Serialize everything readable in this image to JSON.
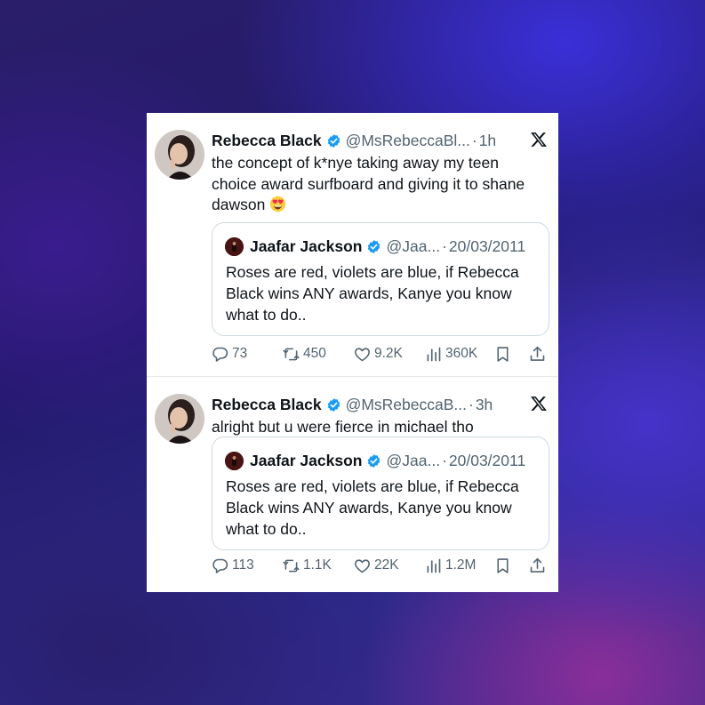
{
  "tweets": [
    {
      "author_name": "Rebecca Black",
      "handle": "@MsRebeccaBl...",
      "separator": "·",
      "time": "1h",
      "text": "the concept of k*nye taking away my teen choice award surfboard and giving it to shane dawson",
      "emoji": "heart-eyes-emoji",
      "quote": {
        "author_name": "Jaafar Jackson",
        "handle": "@Jaa...",
        "separator": "·",
        "date": "20/03/2011",
        "text": "Roses are red, violets are blue, if Rebecca Black wins ANY awards, Kanye you know what to do.."
      },
      "stats": {
        "replies": "73",
        "retweets": "450",
        "likes": "9.2K",
        "views": "360K"
      }
    },
    {
      "author_name": "Rebecca Black",
      "handle": "@MsRebeccaB...",
      "separator": "·",
      "time": "3h",
      "text": "alright but u were fierce in michael tho",
      "quote": {
        "author_name": "Jaafar Jackson",
        "handle": "@Jaa...",
        "separator": "·",
        "date": "20/03/2011",
        "text": "Roses are red, violets are blue, if Rebecca Black wins ANY awards, Kanye you know what to do.."
      },
      "stats": {
        "replies": "113",
        "retweets": "1.1K",
        "likes": "22K",
        "views": "1.2M"
      }
    }
  ],
  "icons": {
    "verified": "verified-badge-icon",
    "x_logo": "x-logo-icon",
    "reply": "reply-icon",
    "retweet": "retweet-icon",
    "like": "heart-icon",
    "views": "views-chart-icon",
    "bookmark": "bookmark-icon",
    "share": "share-icon"
  },
  "colors": {
    "verified_blue": "#1d9bf0",
    "text_primary": "#0f1419",
    "text_secondary": "#536471",
    "border": "#cfd9de"
  }
}
